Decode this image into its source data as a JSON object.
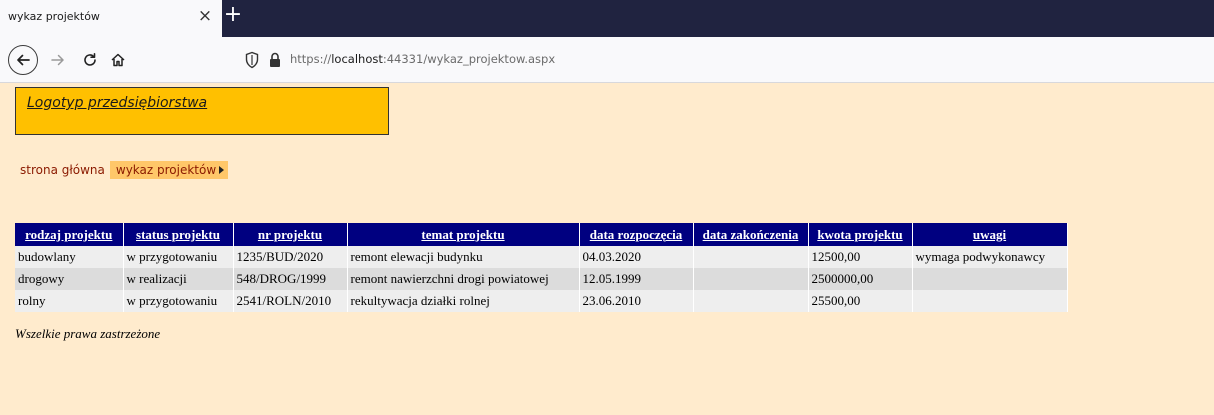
{
  "browser": {
    "tab_title": "wykaz projektów",
    "tab_close": "×",
    "new_tab": "+",
    "url_prefix": "https://",
    "url_host": "localhost",
    "url_rest": ":44331/wykaz_projektow.aspx"
  },
  "header": {
    "logo_text": "Logotyp przedsiębiorstwa",
    "logo_bg": "#FFC000"
  },
  "breadcrumb": {
    "home": "strona główna",
    "current": "wykaz projektów"
  },
  "table": {
    "columns": [
      "rodzaj projektu",
      "status projektu",
      "nr projektu",
      "temat projektu",
      "data rozpoczęcia",
      "data zakończenia",
      "kwota projektu",
      "uwagi"
    ],
    "rows": [
      [
        "budowlany",
        "w przygotowaniu",
        "1235/BUD/2020",
        "remont elewacji budynku",
        "04.03.2020",
        "",
        "12500,00",
        "wymaga podwykonawcy"
      ],
      [
        "drogowy",
        "w realizacji",
        "548/DROG/1999",
        "remont nawierzchni drogi powiatowej",
        "12.05.1999",
        "",
        "2500000,00",
        ""
      ],
      [
        "rolny",
        "w przygotowaniu",
        "2541/ROLN/2010",
        "rekultywacja działki rolnej",
        "23.06.2010",
        "",
        "25500,00",
        ""
      ]
    ],
    "header_bg": "#000080"
  },
  "footer": {
    "text": "Wszelkie prawa zastrzeżone"
  },
  "colors": {
    "page_bg": "#FFEBCD",
    "breadcrumb_active_bg": "#FFC769",
    "breadcrumb_text": "#8B1A00"
  }
}
